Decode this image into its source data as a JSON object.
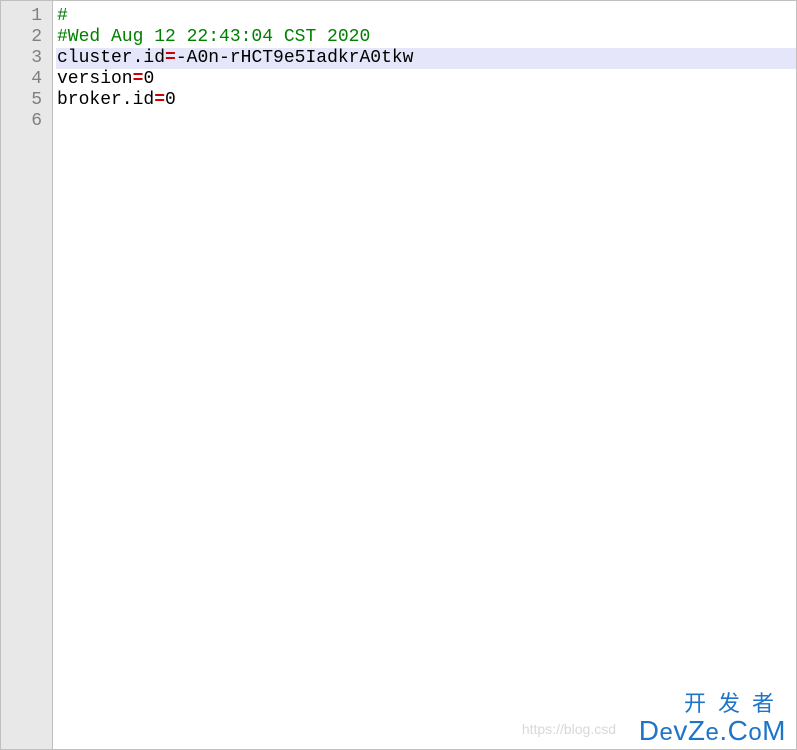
{
  "gutter": {
    "lines": [
      "1",
      "2",
      "3",
      "4",
      "5",
      "6"
    ]
  },
  "code": {
    "line1": {
      "comment": "#"
    },
    "line2": {
      "comment": "#Wed Aug 12 22:43:04 CST 2020"
    },
    "line3": {
      "key": "cluster.id",
      "eq": "=",
      "value": "-A0n-rHCT9e5IadkrA0tkw"
    },
    "line4": {
      "key": "version",
      "eq": "=",
      "value": "0"
    },
    "line5": {
      "key": "broker.id",
      "eq": "=",
      "value": "0"
    }
  },
  "watermark": {
    "faint": "https://blog.csd",
    "cn": "开发者",
    "en_parts": {
      "p1": "D",
      "p2": "e",
      "p3": "v",
      "p4": "Z",
      "p5": "e",
      "p6": ".C",
      "p7": "o",
      "p8": "M"
    }
  }
}
